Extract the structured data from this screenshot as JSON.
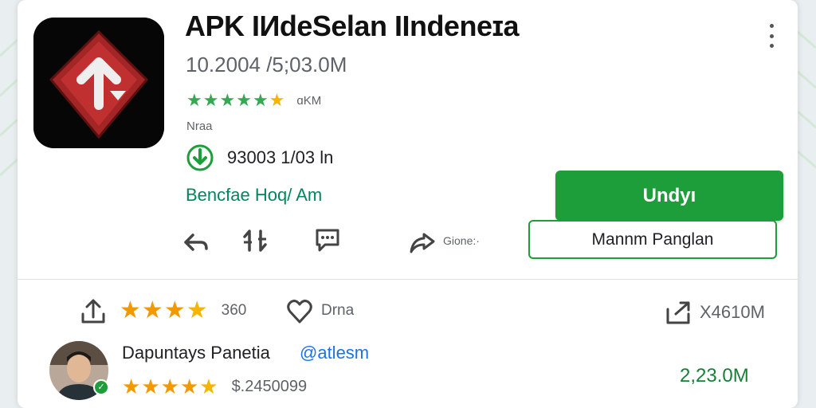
{
  "app": {
    "title": "APK IИdeSelan IIndeneɪa",
    "version": "10.2004 /5;03.0M",
    "rating_count": "ɑKM",
    "category": "Nraa",
    "verified_text": "93003 1/03 ln",
    "developer_link": "Bencfae Hoq/ Am"
  },
  "buttons": {
    "install_label": "Undyı",
    "secondary_label": "Mannm Panglan",
    "share_label": "Gione:·"
  },
  "stats": {
    "rating_count": "360",
    "likes_label": "Drna",
    "size_label": "X4610M"
  },
  "review": {
    "reviewer_name": "Dapuntays Panetia",
    "reviewer_handle": "@atlesm",
    "meta": "$.2450099",
    "downloads": "2,23.0M"
  },
  "icons": [
    "app-logo-icon",
    "more-vert-icon",
    "star-icon",
    "verified-shield-icon",
    "reply-icon",
    "sort-icon",
    "comment-icon",
    "share-icon",
    "upload-icon",
    "heart-icon",
    "download-box-icon"
  ],
  "colors": {
    "accent_green": "#1e9e3b",
    "star_green": "#34a853",
    "star_gold": "#f4b400",
    "star_orange": "#f29900",
    "link_blue": "#1a73e8",
    "logo_red": "#a42525"
  }
}
